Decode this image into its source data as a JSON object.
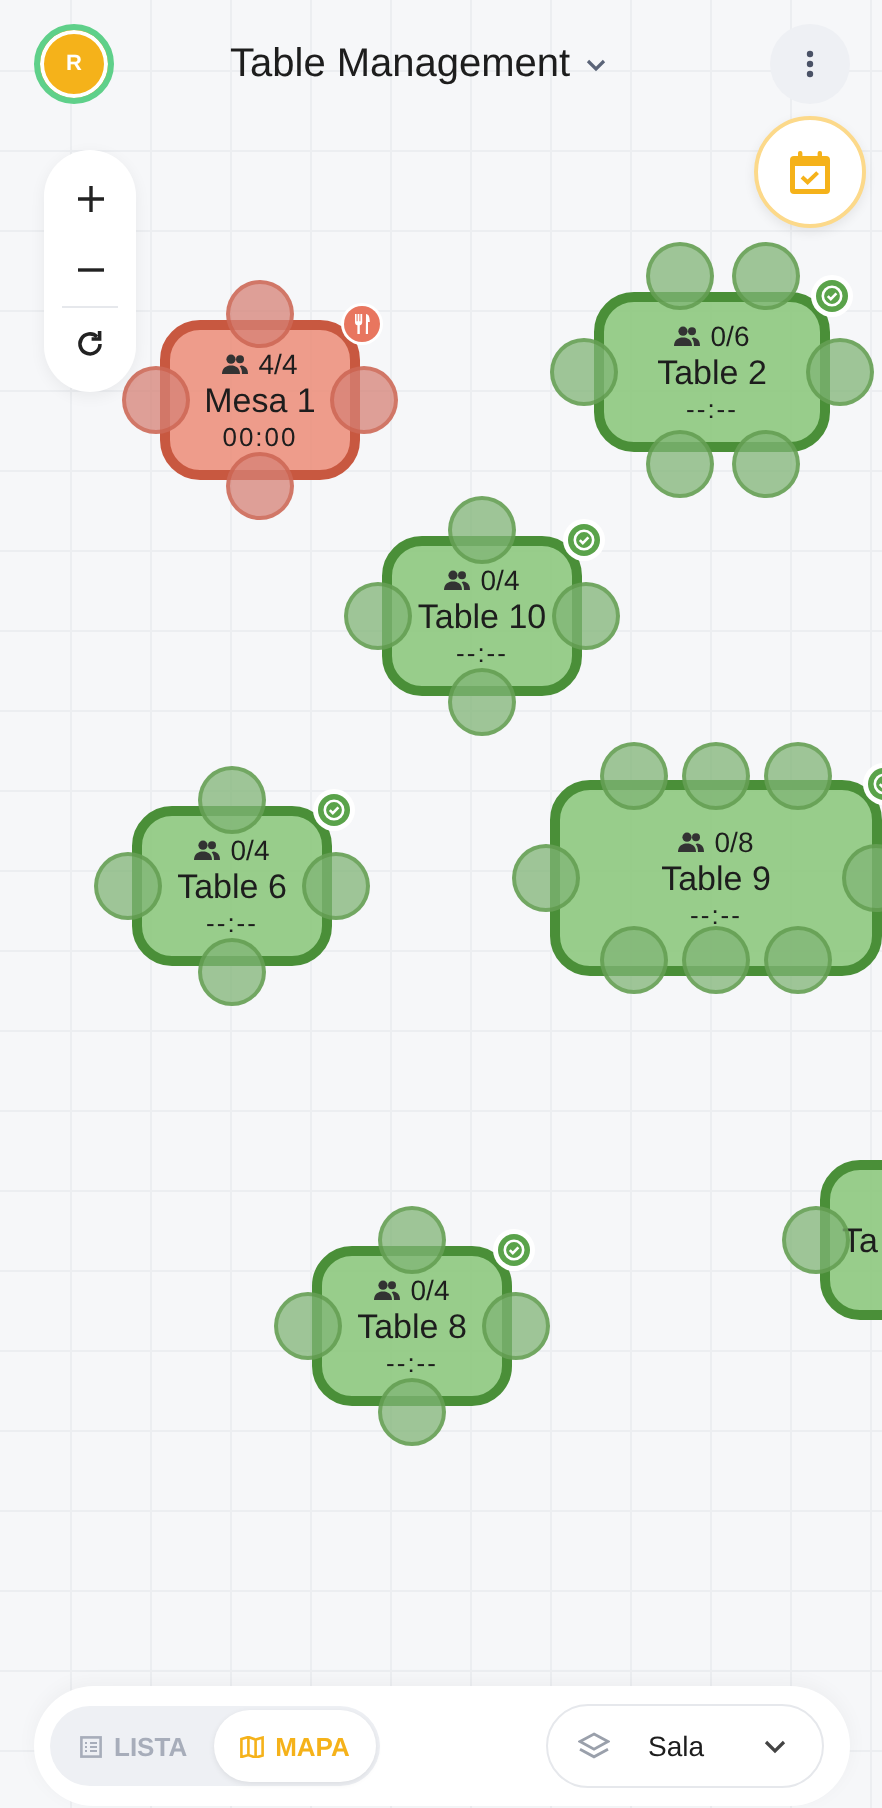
{
  "header": {
    "avatar": "R",
    "title": "Table Management"
  },
  "tables": [
    {
      "name": "Mesa 1",
      "occupancy": "4/4",
      "time": "00:00",
      "occupied": true,
      "kind": "four"
    },
    {
      "name": "Table 2",
      "occupancy": "0/6",
      "time": "--:--",
      "occupied": false,
      "kind": "six"
    },
    {
      "name": "Table 10",
      "occupancy": "0/4",
      "time": "--:--",
      "occupied": false,
      "kind": "four"
    },
    {
      "name": "Table 6",
      "occupancy": "0/4",
      "time": "--:--",
      "occupied": false,
      "kind": "four"
    },
    {
      "name": "Table 9",
      "occupancy": "0/8",
      "time": "--:--",
      "occupied": false,
      "kind": "eight"
    },
    {
      "name": "Table 8",
      "occupancy": "0/4",
      "time": "--:--",
      "occupied": false,
      "kind": "four"
    },
    {
      "name": "Ta",
      "occupied": false,
      "kind": "four"
    }
  ],
  "view_toggle": [
    {
      "label": "LISTA",
      "kind": "list",
      "selected": false
    },
    {
      "label": "MAPA",
      "kind": "map",
      "selected": true
    }
  ],
  "area_select": {
    "value": "Sala"
  }
}
